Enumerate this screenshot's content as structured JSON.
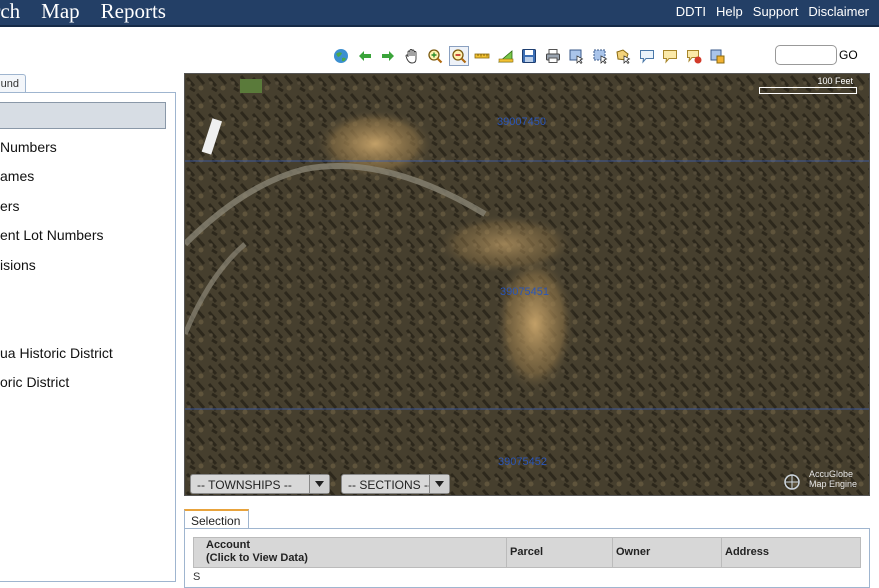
{
  "topnav": {
    "left": [
      "arch",
      "Map",
      "Reports"
    ],
    "right": [
      "DDTI",
      "Help",
      "Support",
      "Disclaimer"
    ]
  },
  "toolbar": {
    "tools": [
      "globe-icon",
      "arrow-left-icon",
      "arrow-right-icon",
      "pan-hand-icon",
      "zoom-in-icon",
      "zoom-out-icon",
      "measure-line-icon",
      "measure-area-icon",
      "save-icon",
      "print-icon",
      "select-point-icon",
      "select-rect-icon",
      "select-polygon-icon",
      "callout-icon",
      "identify-icon",
      "clear-icon",
      "export-icon"
    ],
    "go_label": "GO",
    "goto_value": ""
  },
  "left_panel": {
    "tab_label": "und",
    "items": [
      "Numbers",
      "ames",
      "ers",
      "ent Lot Numbers",
      "isions",
      "ua Historic District",
      "oric District"
    ]
  },
  "map": {
    "scale_label": "100 Feet",
    "parcel_labels": [
      "39007450",
      "39075451",
      "39075452"
    ],
    "townships_label": "-- TOWNSHIPS --",
    "sections_label": "-- SECTIONS --",
    "engine_line1": "AccuGlobe",
    "engine_line2": "Map Engine"
  },
  "selection": {
    "tab_label": "Selection",
    "columns": {
      "account_line1": "Account",
      "account_line2": "(Click to View Data)",
      "parcel": "Parcel",
      "owner": "Owner",
      "address": "Address"
    },
    "row_text": "S"
  },
  "colors": {
    "nav_bg": "#233f66",
    "selection_tab_accent": "#e8a33c",
    "parcel_label": "#2b56b8"
  }
}
